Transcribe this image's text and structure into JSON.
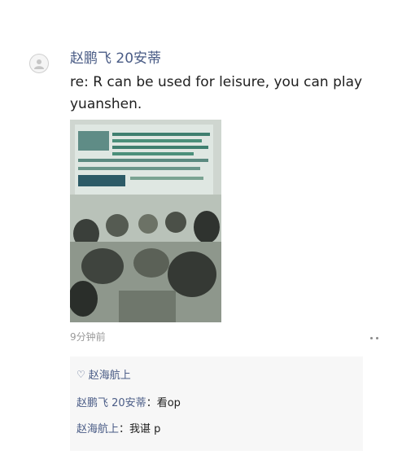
{
  "post": {
    "author": "赵鹏飞 20安蒂",
    "message": "re: R can be used for leisure, you can play yuanshen.",
    "time": "9分钟前",
    "more_icon": "more-dots-icon",
    "photo_icon": "classroom-photo"
  },
  "likes": {
    "icon": "heart-icon",
    "names": "赵海航上"
  },
  "comments": [
    {
      "author": "赵鹏飞 20安蒂",
      "separator": "：",
      "text": "看op"
    },
    {
      "author": "赵海航上",
      "separator": "：",
      "text": "我谌 p"
    }
  ],
  "colors": {
    "name_link": "#4a5c86",
    "text": "#1f1f1f",
    "meta": "#9a9a9a",
    "comment_bg": "#f7f7f7"
  }
}
